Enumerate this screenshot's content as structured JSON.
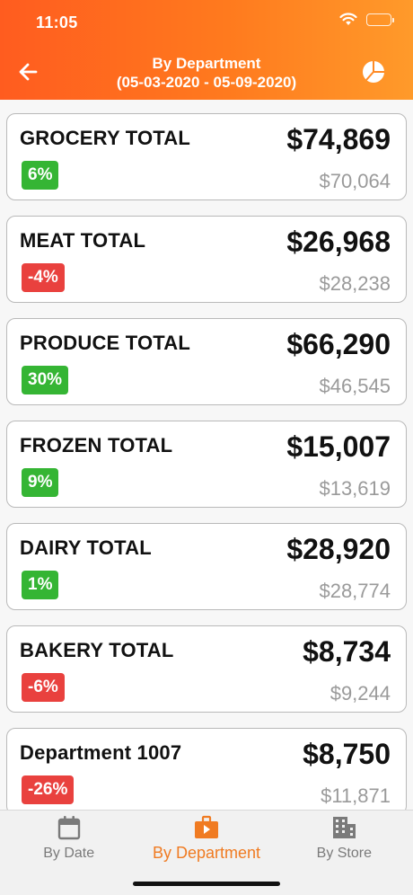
{
  "status_bar": {
    "time": "11:05"
  },
  "header": {
    "title": "By Department",
    "date_range": "(05-03-2020 - 05-09-2020)",
    "back_icon": "arrow-left-icon",
    "chart_icon": "pie-chart-icon"
  },
  "departments": [
    {
      "name": "GROCERY TOTAL",
      "total": "$74,869",
      "change": "6%",
      "direction": "up",
      "previous": "$70,064"
    },
    {
      "name": "MEAT TOTAL",
      "total": "$26,968",
      "change": "-4%",
      "direction": "down",
      "previous": "$28,238"
    },
    {
      "name": "PRODUCE TOTAL",
      "total": "$66,290",
      "change": "30%",
      "direction": "up",
      "previous": "$46,545"
    },
    {
      "name": "FROZEN TOTAL",
      "total": "$15,007",
      "change": "9%",
      "direction": "up",
      "previous": "$13,619"
    },
    {
      "name": "DAIRY TOTAL",
      "total": "$28,920",
      "change": "1%",
      "direction": "up",
      "previous": "$28,774"
    },
    {
      "name": "BAKERY TOTAL",
      "total": "$8,734",
      "change": "-6%",
      "direction": "down",
      "previous": "$9,244"
    },
    {
      "name": "Department 1007",
      "total": "$8,750",
      "change": "-26%",
      "direction": "down",
      "previous": "$11,871"
    }
  ],
  "tabs": [
    {
      "label": "By Date",
      "icon": "calendar-icon",
      "active": false
    },
    {
      "label": "By Department",
      "icon": "briefcase-icon",
      "active": true
    },
    {
      "label": "By Store",
      "icon": "building-icon",
      "active": false
    }
  ],
  "colors": {
    "accent": "#f07b22",
    "positive": "#35b534",
    "negative": "#e9413e"
  }
}
